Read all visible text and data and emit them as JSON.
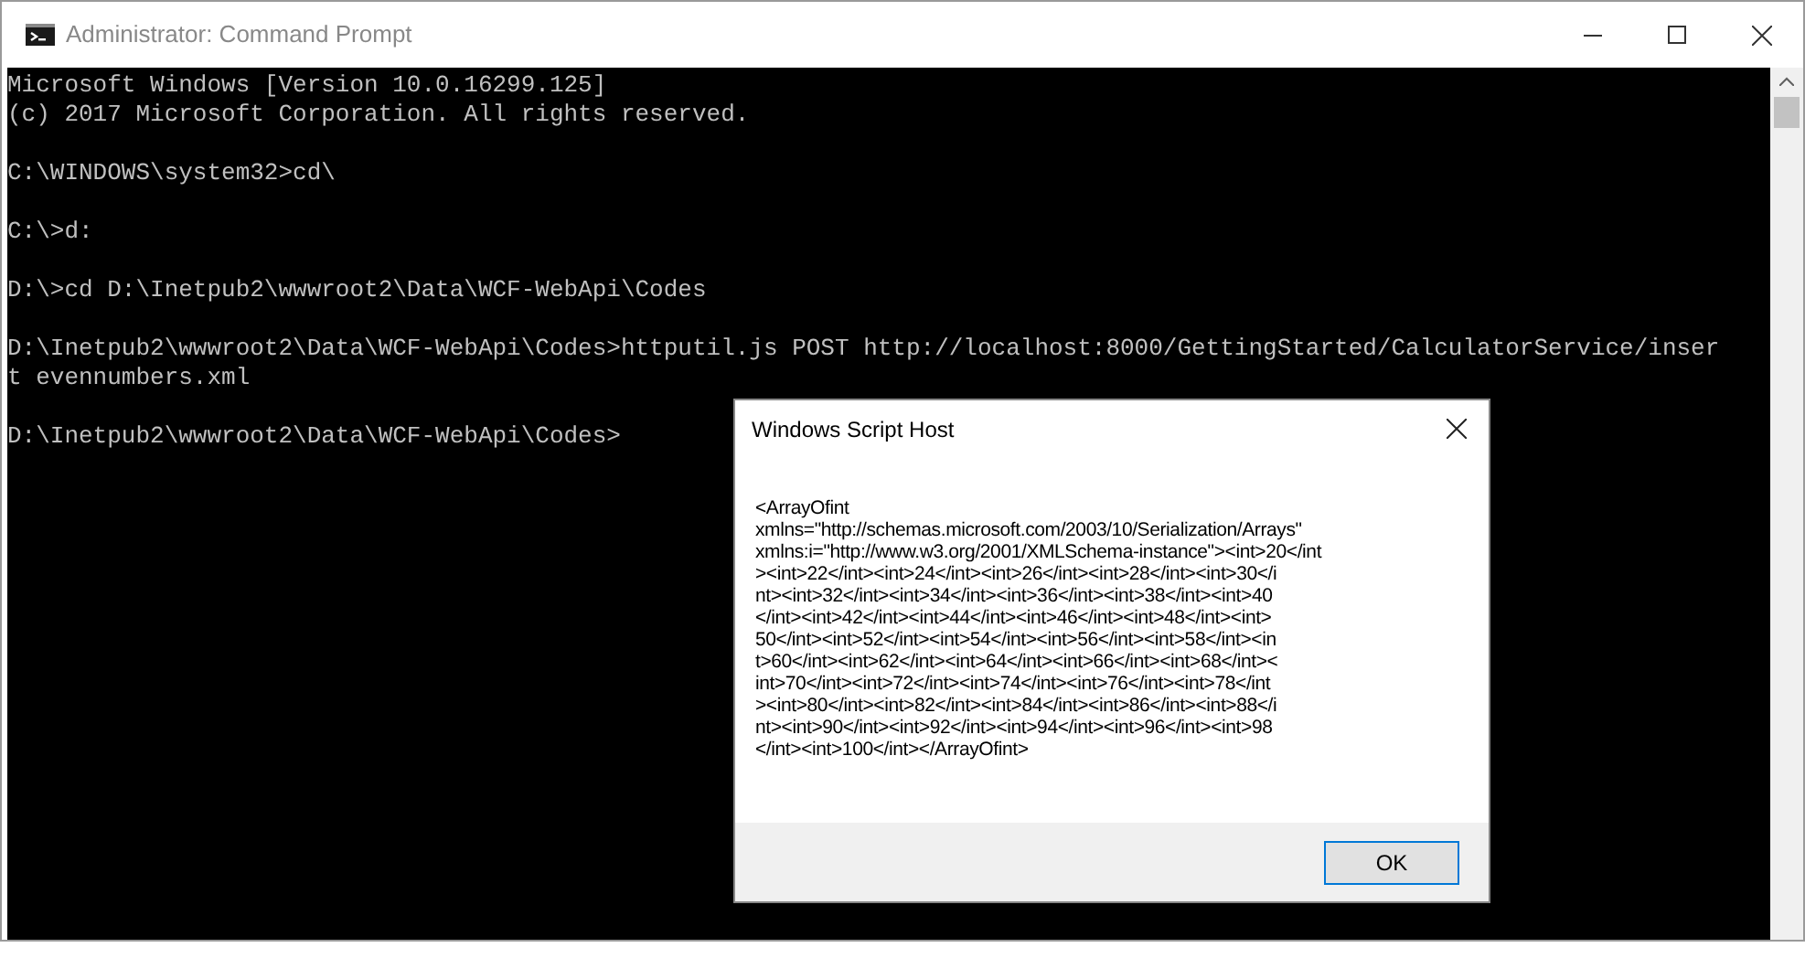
{
  "window": {
    "title": "Administrator: Command Prompt"
  },
  "console": {
    "blocks": [
      [
        "Microsoft Windows [Version 10.0.16299.125]",
        "(c) 2017 Microsoft Corporation. All rights reserved."
      ],
      [
        "C:\\WINDOWS\\system32>cd\\"
      ],
      [
        "C:\\>d:"
      ],
      [
        "D:\\>cd D:\\Inetpub2\\wwwroot2\\Data\\WCF-WebApi\\Codes"
      ],
      [
        "D:\\Inetpub2\\wwwroot2\\Data\\WCF-WebApi\\Codes>httputil.js POST http://localhost:8000/GettingStarted/CalculatorService/inser",
        "t evennumbers.xml"
      ],
      [
        "D:\\Inetpub2\\wwwroot2\\Data\\WCF-WebApi\\Codes>"
      ]
    ]
  },
  "dialog": {
    "title": "Windows Script Host",
    "message_lines": [
      "<ArrayOfint",
      "xmlns=\"http://schemas.microsoft.com/2003/10/Serialization/Arrays\"",
      "xmlns:i=\"http://www.w3.org/2001/XMLSchema-instance\"><int>20</int",
      "><int>22</int><int>24</int><int>26</int><int>28</int><int>30</i",
      "nt><int>32</int><int>34</int><int>36</int><int>38</int><int>40",
      "</int><int>42</int><int>44</int><int>46</int><int>48</int><int>",
      "50</int><int>52</int><int>54</int><int>56</int><int>58</int><in",
      "t>60</int><int>62</int><int>64</int><int>66</int><int>68</int><",
      "int>70</int><int>72</int><int>74</int><int>76</int><int>78</int",
      "><int>80</int><int>82</int><int>84</int><int>86</int><int>88</i",
      "nt><int>90</int><int>92</int><int>94</int><int>96</int><int>98",
      "</int><int>100</int></ArrayOfint>"
    ],
    "button": "OK"
  }
}
